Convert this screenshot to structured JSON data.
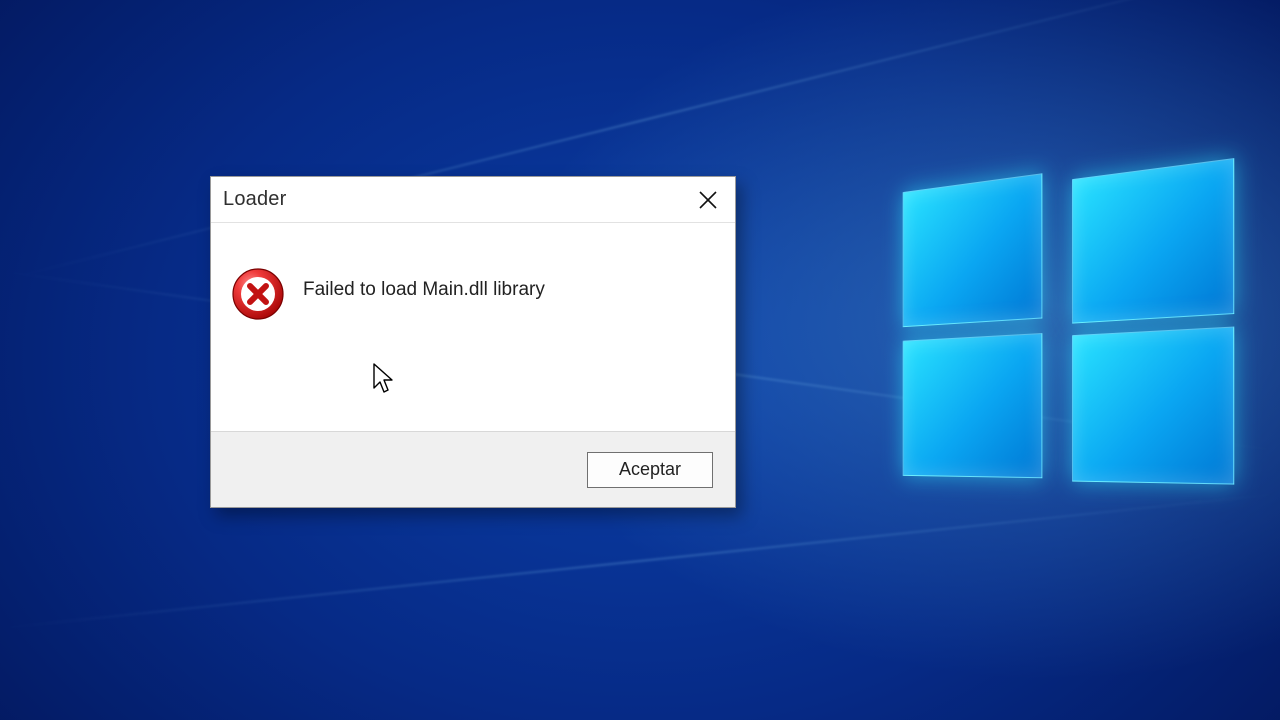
{
  "dialog": {
    "title": "Loader",
    "message": "Failed to load Main.dll library",
    "accept_label": "Aceptar"
  }
}
